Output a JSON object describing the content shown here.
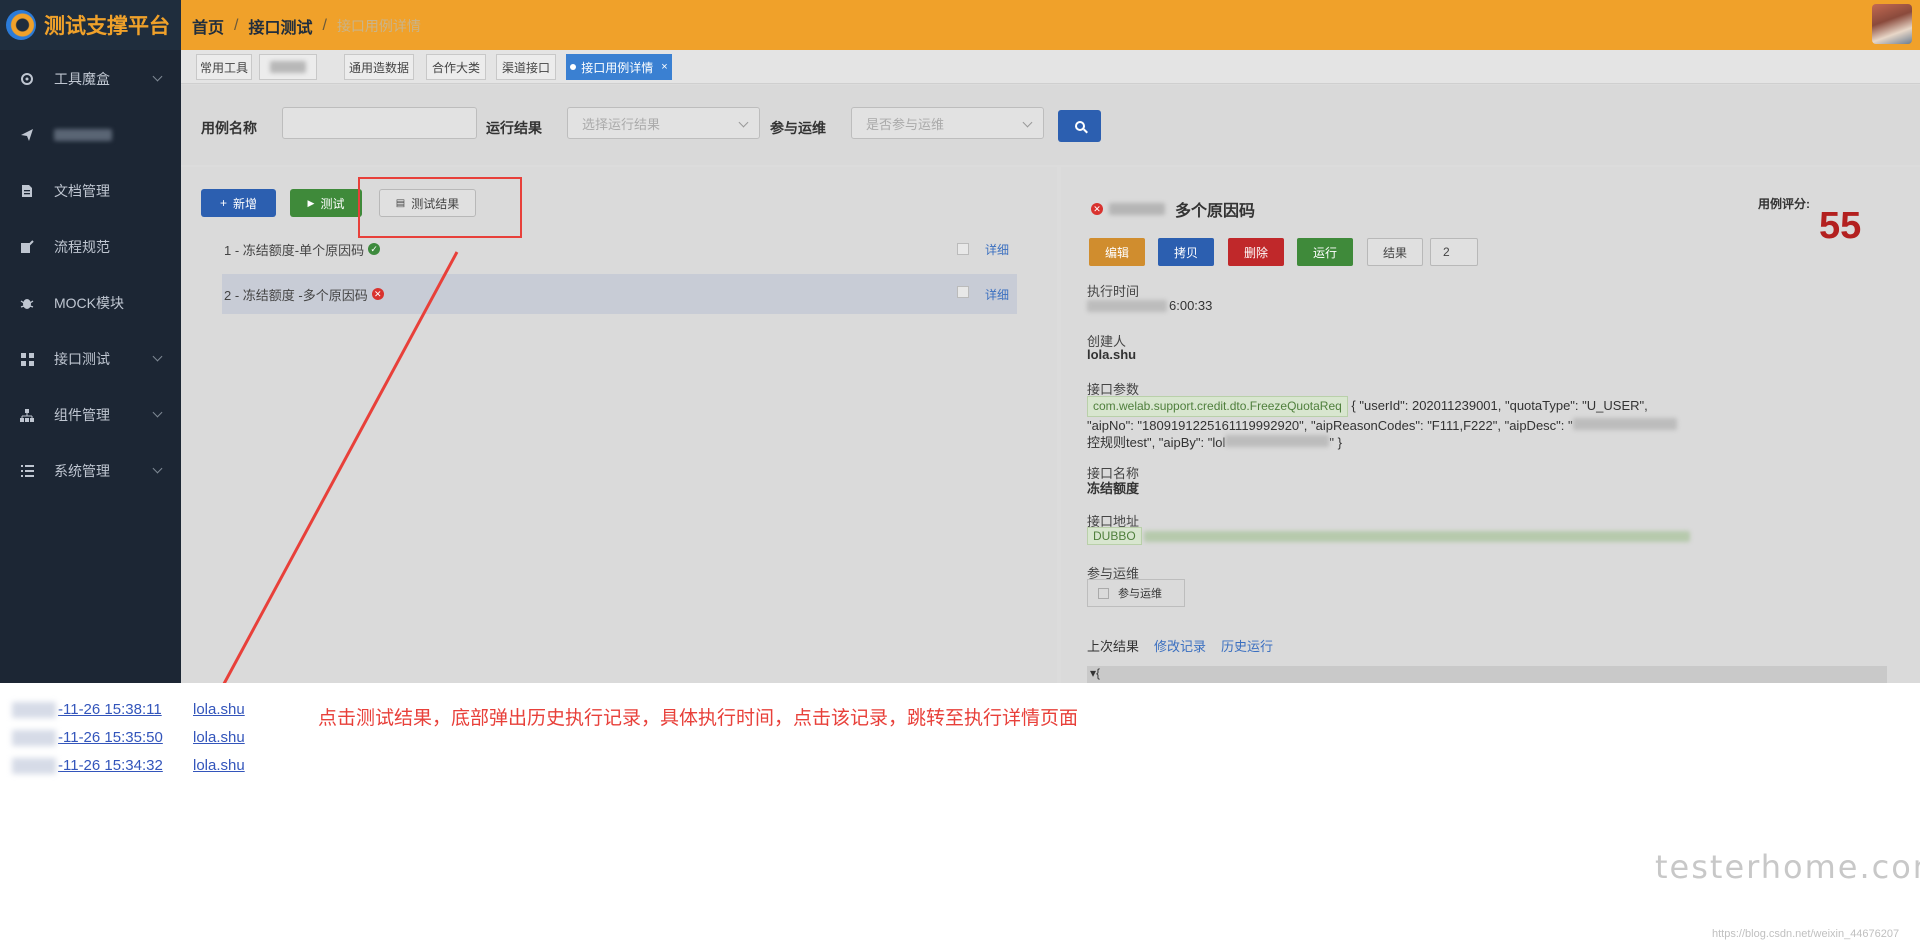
{
  "header": {
    "app_title": "测试支撑平台",
    "breadcrumb": [
      "首页",
      "接口测试",
      "接口用例详情"
    ],
    "colors": {
      "bar": "#f0a12a",
      "sidebar": "#1c2634"
    }
  },
  "sidebar": {
    "items": [
      {
        "label": "工具魔盒",
        "icon": "gear-icon",
        "has_chevron": true
      },
      {
        "label": "",
        "icon": "send-icon",
        "has_chevron": false
      },
      {
        "label": "文档管理",
        "icon": "document-icon",
        "has_chevron": false
      },
      {
        "label": "流程规范",
        "icon": "edit-icon",
        "has_chevron": false
      },
      {
        "label": "MOCK模块",
        "icon": "bug-icon",
        "has_chevron": false
      },
      {
        "label": "接口测试",
        "icon": "grid-icon",
        "has_chevron": true
      },
      {
        "label": "组件管理",
        "icon": "hierarchy-icon",
        "has_chevron": true
      },
      {
        "label": "系统管理",
        "icon": "list-icon",
        "has_chevron": true
      }
    ]
  },
  "tabs": [
    {
      "label": "常用工具"
    },
    {
      "label": ""
    },
    {
      "label": "通用造数据"
    },
    {
      "label": "合作大类"
    },
    {
      "label": "渠道接口"
    },
    {
      "label": "接口用例详情",
      "active": true,
      "close": "×"
    }
  ],
  "filter": {
    "case_name_label": "用例名称",
    "case_name_value": "",
    "run_result_label": "运行结果",
    "run_result_placeholder": "选择运行结果",
    "ops_label": "参与运维",
    "ops_placeholder": "是否参与运维"
  },
  "toolbar": {
    "add_label": "新增",
    "test_label": "测试",
    "result_label": "测试结果"
  },
  "cases": [
    {
      "label": "1 - 冻结额度-单个原因码",
      "status": "success",
      "detail": "详细"
    },
    {
      "label": "2 - 冻结额度 -多个原因码",
      "status": "error",
      "detail": "详细"
    }
  ],
  "detail": {
    "title": "多个原因码",
    "score_label": "用例评分:",
    "score": "55",
    "actions": {
      "edit": "编辑",
      "copy": "拷贝",
      "delete": "删除",
      "run": "运行",
      "result": "结果",
      "count": "2"
    },
    "exec_time_label": "执行时间",
    "exec_time_value": "6:00:33",
    "creator_label": "创建人",
    "creator_value": "lola.shu",
    "params_label": "接口参数",
    "params_class": "com.welab.support.credit.dto.FreezeQuotaReq",
    "params_line1": "{ \"userId\": 202011239001, \"quotaType\": \"U_USER\",",
    "params_line2": "\"aipNo\": \"1809191225161119992920\", \"aipReasonCodes\": \"F111,F222\", \"aipDesc\": \"",
    "params_line3": "控规则test\", \"aipBy\": \"lol",
    "params_line3_end": "\" }",
    "api_name_label": "接口名称",
    "api_name_value": "冻结额度",
    "api_addr_label": "接口地址",
    "api_addr_tag": "DUBBO",
    "ops_label": "参与运维",
    "ops_checkbox": "参与运维",
    "last_result": "上次结果",
    "edit_history": "修改记录",
    "history_run": "历史运行",
    "json_preview": "▾{"
  },
  "history": [
    {
      "time": "-11-26 15:38:11",
      "user": "lola.shu"
    },
    {
      "time": "-11-26 15:35:50",
      "user": "lola.shu"
    },
    {
      "time": "-11-26 15:34:32",
      "user": "lola.shu"
    }
  ],
  "annotation": "点击测试结果，底部弹出历史执行记录，具体执行时间，点击该记录，跳转至执行详情页面",
  "watermark": "testerhome.com",
  "watermark_url": "https://blog.csdn.net/weixin_44676207"
}
